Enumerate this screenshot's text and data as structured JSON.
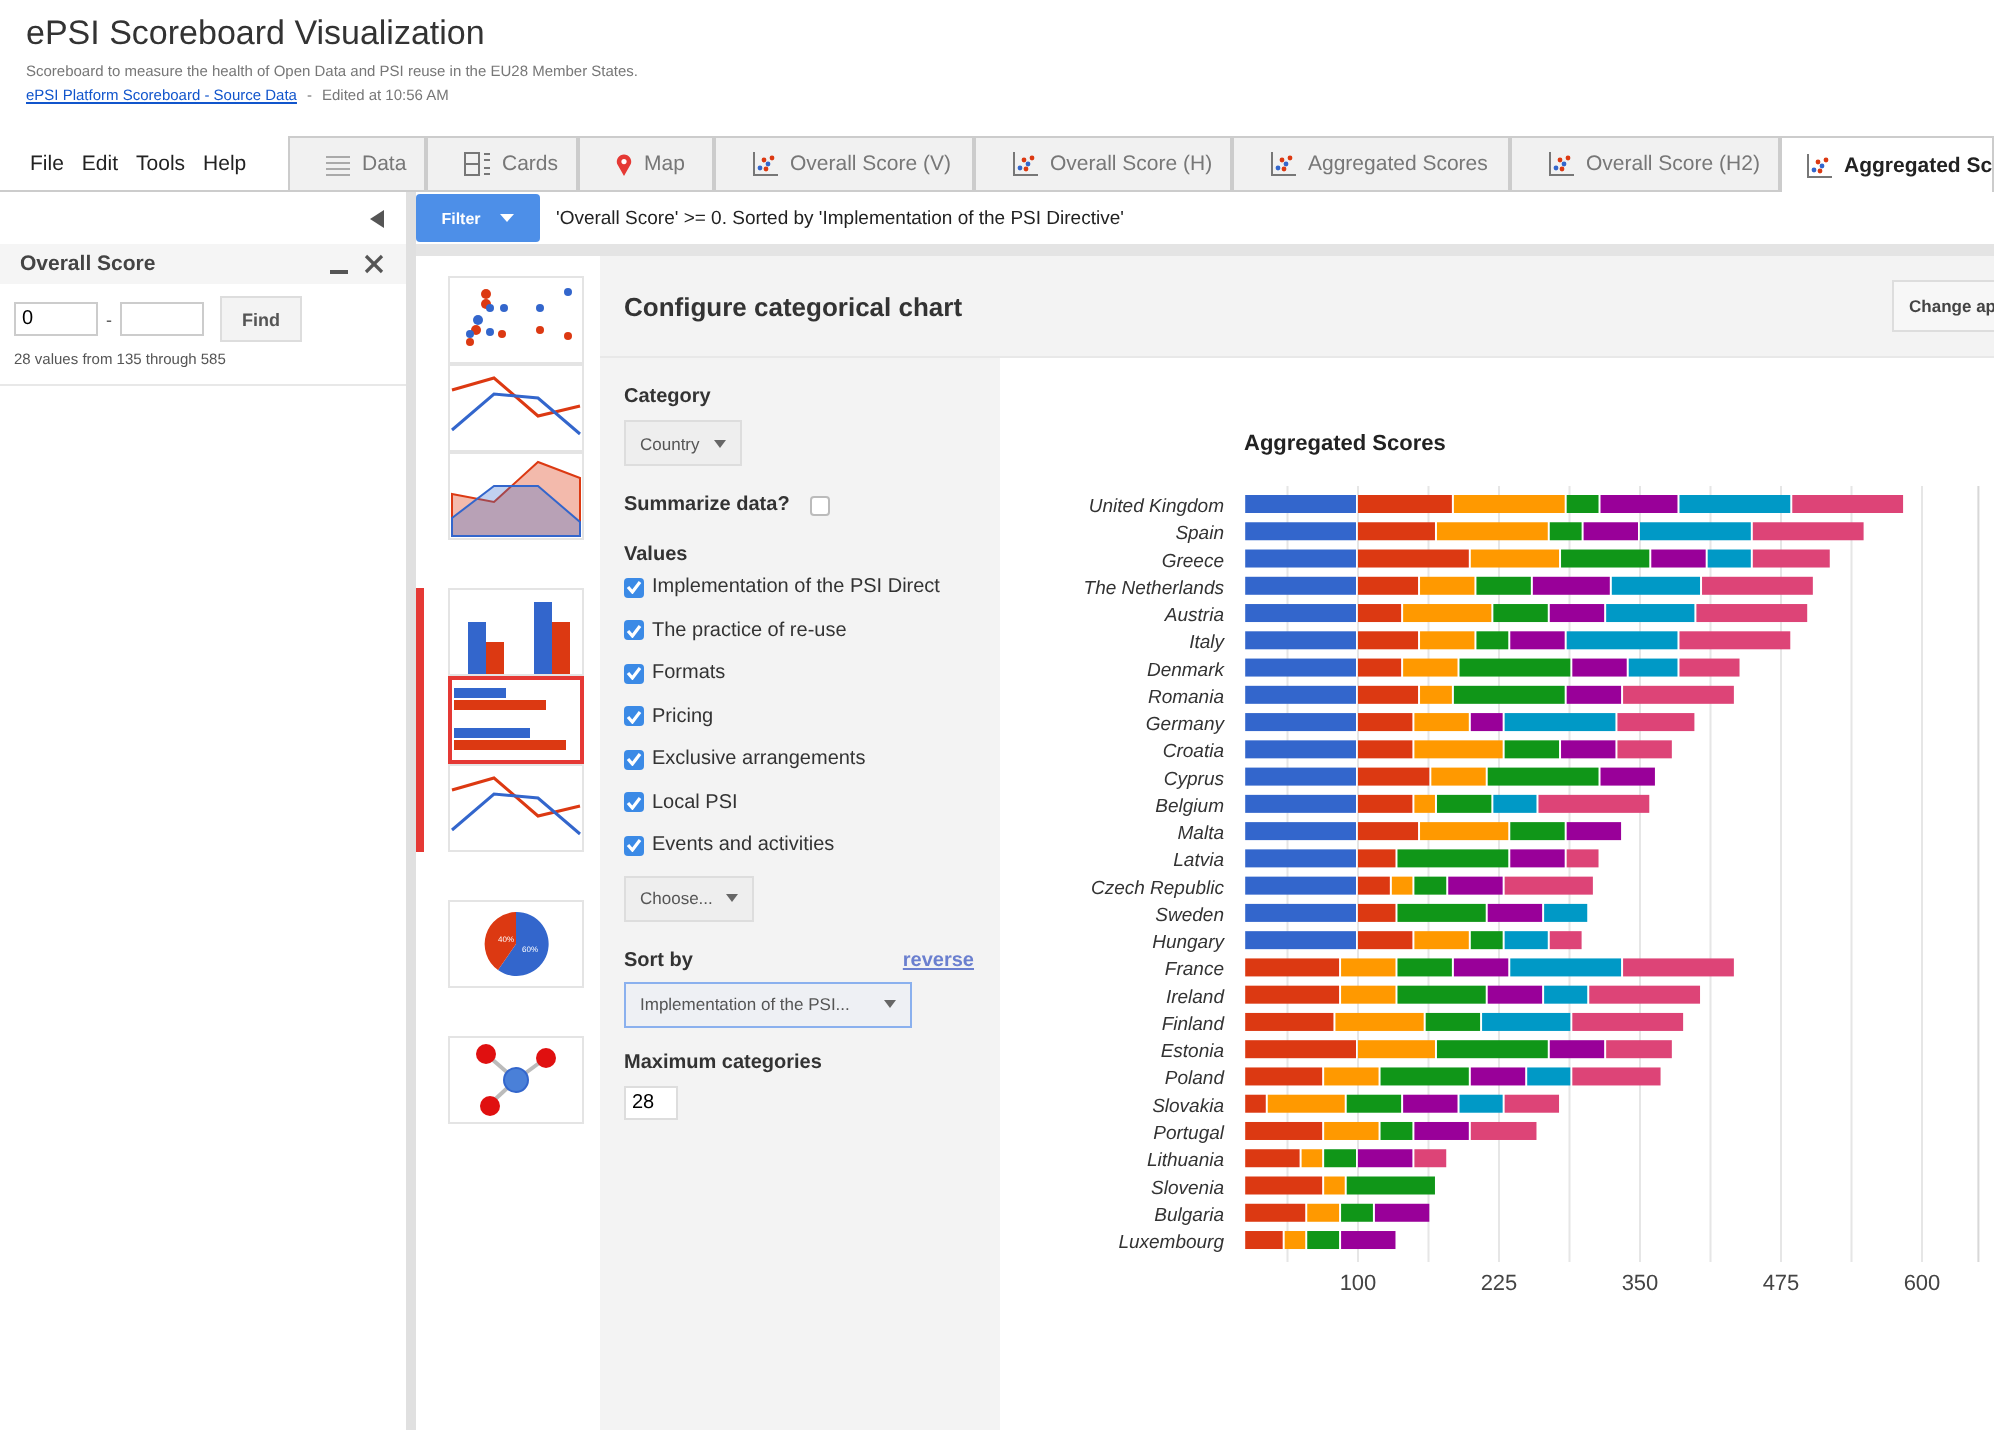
{
  "header": {
    "title": "ePSI Scoreboard Visualization",
    "subtitle": "Scoreboard to measure the health of Open Data and PSI reuse in the EU28 Member States.",
    "source_link": "ePSI Platform Scoreboard - Source Data",
    "separator": "-",
    "edited": "Edited at 10:56 AM"
  },
  "menu": [
    "File",
    "Edit",
    "Tools",
    "Help"
  ],
  "tabs": [
    {
      "label": "Data",
      "kind": "data",
      "selected": false
    },
    {
      "label": "Cards",
      "kind": "cards",
      "selected": false
    },
    {
      "label": "Map",
      "kind": "map",
      "selected": false
    },
    {
      "label": "Overall Score (V)",
      "kind": "chart",
      "selected": false
    },
    {
      "label": "Overall Score (H)",
      "kind": "chart",
      "selected": false
    },
    {
      "label": "Aggregated Scores",
      "kind": "chart",
      "selected": false
    },
    {
      "label": "Overall Score (H2)",
      "kind": "chart",
      "selected": false
    },
    {
      "label": "Aggregated Sc",
      "kind": "chart",
      "selected": true
    }
  ],
  "filter_bar": {
    "button": "Filter",
    "description": "'Overall Score' >= 0. Sorted by 'Implementation of the PSI Directive'"
  },
  "filter_panel": {
    "title": "Overall Score",
    "min_value": "0",
    "range_separator": "-",
    "find_button": "Find",
    "summary": "28 values from 135 through 585"
  },
  "chart_types": [
    {
      "items": [
        {
          "kind": "scatter",
          "selected": false
        },
        {
          "kind": "line",
          "selected": false
        },
        {
          "kind": "area",
          "selected": false
        }
      ]
    },
    {
      "items": [
        {
          "kind": "column",
          "selected": false
        },
        {
          "kind": "bar",
          "selected": true
        },
        {
          "kind": "line",
          "selected": false
        }
      ]
    },
    {
      "items": [
        {
          "kind": "pie",
          "selected": false,
          "labels": [
            "40%",
            "60%"
          ]
        }
      ]
    },
    {
      "items": [
        {
          "kind": "network",
          "selected": false
        }
      ]
    }
  ],
  "config": {
    "heading": "Configure categorical chart",
    "change_button": "Change ap",
    "category_label": "Category",
    "category_value": "Country",
    "summarize_label": "Summarize data?",
    "summarize_checked": false,
    "values_label": "Values",
    "values": [
      {
        "label": "Implementation of the PSI Direct",
        "checked": true
      },
      {
        "label": "The practice of re-use",
        "checked": true
      },
      {
        "label": "Formats",
        "checked": true
      },
      {
        "label": "Pricing",
        "checked": true
      },
      {
        "label": "Exclusive arrangements",
        "checked": true
      },
      {
        "label": "Local PSI",
        "checked": true
      },
      {
        "label": "Events and activities",
        "checked": true
      }
    ],
    "choose_button": "Choose...",
    "sort_label": "Sort by",
    "reverse_link": "reverse",
    "sort_value": "Implementation of the PSI...",
    "max_label": "Maximum categories",
    "max_value": "28"
  },
  "chart": {
    "chart_data": {
      "type": "bar",
      "orientation": "horizontal",
      "stacked": true,
      "title": "Aggregated Scores",
      "categories": [
        "United Kingdom",
        "Spain",
        "Greece",
        "The Netherlands",
        "Austria",
        "Italy",
        "Denmark",
        "Romania",
        "Germany",
        "Croatia",
        "Cyprus",
        "Belgium",
        "Malta",
        "Latvia",
        "Czech Republic",
        "Sweden",
        "Hungary",
        "France",
        "Ireland",
        "Finland",
        "Estonia",
        "Poland",
        "Slovakia",
        "Portugal",
        "Lithuania",
        "Slovenia",
        "Bulgaria",
        "Luxembourg"
      ],
      "grid": true,
      "xlim": [
        0,
        650
      ],
      "xticks": [
        100,
        225,
        350,
        475,
        600
      ],
      "series": [
        {
          "color": "#3366cc",
          "values": [
            100,
            100,
            100,
            100,
            100,
            100,
            100,
            100,
            100,
            100,
            100,
            100,
            100,
            100,
            100,
            100,
            100,
            0,
            0,
            0,
            0,
            0,
            0,
            0,
            0,
            0,
            0,
            0
          ]
        },
        {
          "color": "#dc3912",
          "values": [
            85,
            70,
            100,
            55,
            40,
            55,
            40,
            55,
            50,
            50,
            65,
            50,
            55,
            35,
            30,
            35,
            50,
            85,
            85,
            80,
            100,
            70,
            20,
            70,
            50,
            70,
            55,
            35
          ]
        },
        {
          "color": "#ff9900",
          "values": [
            100,
            100,
            80,
            50,
            80,
            50,
            50,
            30,
            50,
            80,
            50,
            20,
            80,
            0,
            20,
            0,
            50,
            50,
            50,
            80,
            70,
            50,
            70,
            50,
            20,
            20,
            30,
            20
          ]
        },
        {
          "color": "#109618",
          "values": [
            30,
            30,
            80,
            50,
            50,
            30,
            100,
            100,
            0,
            50,
            100,
            50,
            50,
            100,
            30,
            80,
            30,
            50,
            80,
            50,
            100,
            80,
            50,
            30,
            30,
            80,
            30,
            30
          ]
        },
        {
          "color": "#990099",
          "values": [
            70,
            50,
            50,
            70,
            50,
            50,
            50,
            50,
            30,
            50,
            50,
            0,
            50,
            50,
            50,
            50,
            0,
            50,
            50,
            0,
            50,
            50,
            50,
            50,
            50,
            0,
            50,
            50
          ]
        },
        {
          "color": "#0099c6",
          "values": [
            100,
            100,
            40,
            80,
            80,
            100,
            45,
            0,
            100,
            0,
            0,
            40,
            0,
            0,
            0,
            40,
            40,
            100,
            40,
            80,
            0,
            40,
            40,
            0,
            0,
            0,
            0,
            0
          ]
        },
        {
          "color": "#dd4477",
          "values": [
            100,
            100,
            70,
            100,
            100,
            100,
            55,
            100,
            70,
            50,
            0,
            100,
            0,
            30,
            80,
            0,
            30,
            100,
            100,
            100,
            60,
            80,
            50,
            60,
            30,
            0,
            0,
            0
          ]
        }
      ]
    }
  }
}
